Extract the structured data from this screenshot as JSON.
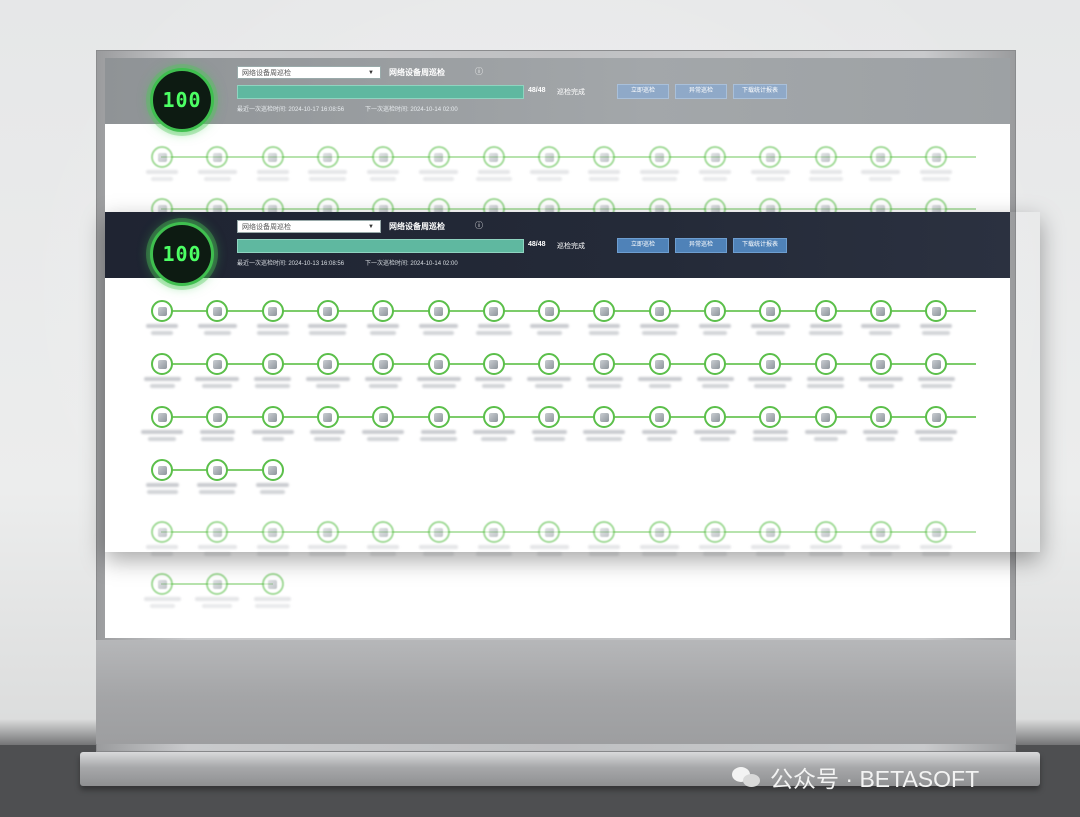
{
  "dashboard": {
    "score": "100",
    "select_value": "网络设备周巡检",
    "title": "网络设备周巡检",
    "info_symbol": "ⓘ",
    "progress": {
      "done": 48,
      "total": 48,
      "fraction": 1.0
    },
    "count_text": "48/48",
    "status": "巡检完成",
    "buttons": [
      "立即巡检",
      "异常巡检",
      "下载统计报表"
    ],
    "last_inspection_label": "最近一次巡检时间:",
    "next_inspection_label": "下一次巡检时间:",
    "ghost_last_time": "2024-10-17 16:08:56",
    "main_last_time": "2024-10-13 16:08:56",
    "next_time": "2024-10-14 02:00",
    "select_arrow": "▼"
  },
  "node_rows": [
    15,
    15,
    15,
    3
  ],
  "watermark": {
    "text": "公众号 · BETASOFT",
    "icon": "wechat-icon"
  },
  "colors": {
    "accent_green": "#5bbf4a",
    "header_dark": "#1f2432",
    "button_blue": "#4f82b8",
    "progress": "#5fb8a0"
  }
}
